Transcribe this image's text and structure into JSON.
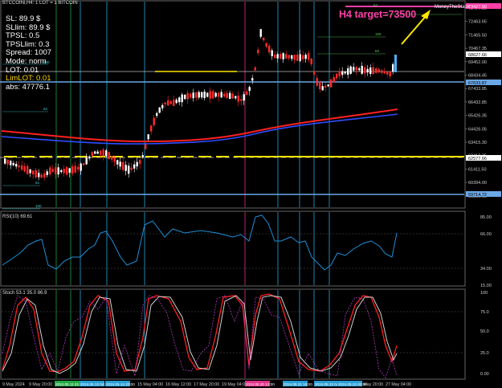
{
  "header": {
    "title": "BTCCOINi,H4: 1 LOT = 1 BITCOIN",
    "logo_text": "MoneyTheStack"
  },
  "info_panel": {
    "lines": [
      "SL: 89.9 $",
      "SLlim: 89.9 $",
      "TPSL: 0.5",
      "TPSLlim: 0.3",
      "Spread: 1007",
      "Mode: norm",
      "LOT: 0.01"
    ],
    "limlot": "LimLOT: 0.01",
    "abs": "abs: 47776.1"
  },
  "target_label": "H4 target=73500",
  "price_axis": {
    "ticks": [
      "73477.50",
      "72463.65",
      "71465.50",
      "70467.35",
      "69452.00",
      "68434.45",
      "67433.85",
      "66432.85",
      "65426.35",
      "64426.05",
      "63415.30",
      "62412.35",
      "61411.50",
      "60394.00",
      "59380.65"
    ],
    "labels": {
      "target_level": "73427.50",
      "current_price": "68627.66",
      "blue_upper": "67633.87",
      "blue_lower": "59714.72",
      "yellow_level": "62577.66"
    }
  },
  "level_labels": {
    "l100_top": "100",
    "l62_top": "62",
    "l62_top_right": "62",
    "l100_mid": "100",
    "l62_mid": "62",
    "l62_low": "62",
    "l100_low": "100",
    "l100_right": "100"
  },
  "rsi": {
    "title": "RSI(10) 69.61",
    "ticks": [
      "85.00",
      "66.00",
      "34.00",
      "15.00"
    ]
  },
  "stoch": {
    "title": "Stoch 53.1 35.0 86.9",
    "ticks": [
      "100",
      "75.0",
      "50.0",
      "25.0",
      "0.00"
    ]
  },
  "time_axis": {
    "labels": [
      "9 May 2024",
      "9 May 20:00",
      "",
      "",
      "",
      "15 May 04:00",
      "16 May 12:00",
      "17 May 20:00",
      "19 May 04:00",
      "20 M",
      "",
      "",
      "",
      "",
      "25 May 20:00",
      "27 May 04:00"
    ],
    "highlighted": [
      {
        "text": "2024.05.11 01:00",
        "color": "#22aa44"
      },
      {
        "text": "2024.05.13 04:00",
        "color": "#2a9fd6"
      },
      {
        "text": "2024.05.14 20:00",
        "color": "#2a9fd6"
      },
      {
        "text": "2024.05.20 12:00",
        "color": "#e0338a"
      },
      {
        "text": "2024.05.21 15:00",
        "color": "#2a9fd6"
      },
      {
        "text": "2024.05.23 04:00",
        "color": "#2a9fd6"
      },
      {
        "text": "2024.05.24 00:00",
        "color": "#2a9fd6"
      }
    ]
  },
  "colors": {
    "bull": "#ffffff",
    "bear": "#ff2a2a",
    "ma_red": "#ff2020",
    "ma_blue": "#2f4dff",
    "yellow": "#ffe600",
    "cyan": "#29a8e0",
    "magenta": "#e0338a",
    "green": "#20a040",
    "pink": "#ff3fa8"
  }
}
